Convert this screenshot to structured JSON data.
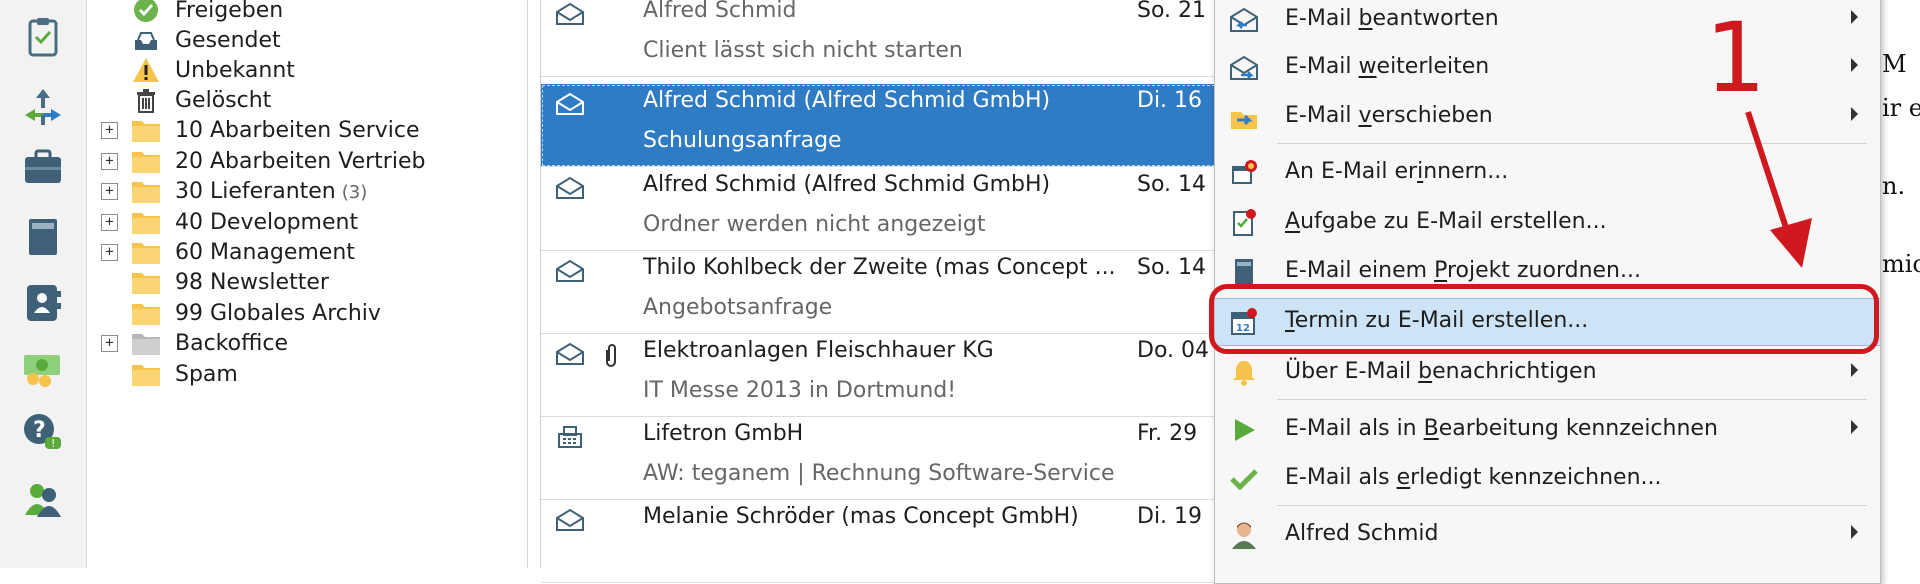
{
  "colors": {
    "accent": "#2f7bc4",
    "annotation": "#d0181f",
    "folder": "#f6c34c",
    "highlight": "#cde4f7"
  },
  "rail": {
    "items": [
      {
        "icon": "tasks-clipboard-icon"
      },
      {
        "icon": "routing-arrows-icon"
      },
      {
        "icon": "briefcase-icon"
      },
      {
        "icon": "archive-cabinet-icon"
      },
      {
        "icon": "contacts-book-icon"
      },
      {
        "icon": "money-icon"
      },
      {
        "icon": "help-chat-icon"
      },
      {
        "icon": "users-icon"
      }
    ]
  },
  "folders": [
    {
      "label": "Freigeben",
      "icon": "check-circle-icon",
      "expandable": false,
      "count": ""
    },
    {
      "label": "Gesendet",
      "icon": "outbox-tray-icon",
      "expandable": false,
      "count": ""
    },
    {
      "label": "Unbekannt",
      "icon": "warning-icon",
      "expandable": false,
      "count": ""
    },
    {
      "label": "Gelöscht",
      "icon": "trash-icon",
      "expandable": false,
      "count": ""
    },
    {
      "label": "10 Abarbeiten Service",
      "icon": "folder-icon",
      "expandable": true,
      "count": ""
    },
    {
      "label": "20 Abarbeiten Vertrieb",
      "icon": "folder-icon",
      "expandable": true,
      "count": ""
    },
    {
      "label": "30 Lieferanten",
      "icon": "folder-icon",
      "expandable": true,
      "count": "(3)"
    },
    {
      "label": "40 Development",
      "icon": "folder-icon",
      "expandable": true,
      "count": ""
    },
    {
      "label": "60 Management",
      "icon": "folder-icon",
      "expandable": true,
      "count": ""
    },
    {
      "label": "98 Newsletter",
      "icon": "folder-icon",
      "expandable": false,
      "count": ""
    },
    {
      "label": "99 Globales Archiv",
      "icon": "folder-icon",
      "expandable": false,
      "count": ""
    },
    {
      "label": "Backoffice",
      "icon": "gray-folder-icon",
      "expandable": true,
      "count": ""
    },
    {
      "label": "Spam",
      "icon": "folder-icon",
      "expandable": false,
      "count": ""
    }
  ],
  "expander_symbol": "+",
  "mails": [
    {
      "sender": "Alfred Schmid",
      "subject": "Client lässt sich nicht starten",
      "day": "So. 21",
      "icon": "envelope-open-icon",
      "attachment": false,
      "selected": false,
      "read": true
    },
    {
      "sender": "Alfred Schmid (Alfred Schmid GmbH)",
      "subject": "Schulungsanfrage",
      "day": "Di. 16",
      "icon": "envelope-open-icon",
      "attachment": false,
      "selected": true,
      "read": false
    },
    {
      "sender": "Alfred Schmid (Alfred Schmid GmbH)",
      "subject": "Ordner werden nicht angezeigt",
      "day": "So. 14",
      "icon": "envelope-open-icon",
      "attachment": false,
      "selected": false,
      "read": false
    },
    {
      "sender": "Thilo Kohlbeck der Zweite (mas Concept ...",
      "subject": "Angebotsanfrage",
      "day": "So. 14",
      "icon": "envelope-open-icon",
      "attachment": false,
      "selected": false,
      "read": false
    },
    {
      "sender": "Elektroanlagen Fleischhauer KG",
      "subject": "IT Messe 2013 in Dortmund!",
      "day": "Do. 04",
      "icon": "envelope-open-icon",
      "attachment": true,
      "selected": false,
      "read": false
    },
    {
      "sender": "Lifetron GmbH",
      "subject": "AW: teganem | Rechnung Software-Service",
      "day": "Fr. 29",
      "icon": "fax-icon",
      "attachment": false,
      "selected": false,
      "read": false
    },
    {
      "sender": "Melanie Schröder (mas Concept GmbH)",
      "subject": "",
      "day": "Di. 19",
      "icon": "envelope-open-icon",
      "attachment": false,
      "selected": false,
      "read": false
    }
  ],
  "reading_pane": {
    "fragments": [
      "M",
      "ir e",
      "n.",
      "mic"
    ]
  },
  "context_menu": {
    "items": [
      {
        "pre": "E-Mail ",
        "key": "b",
        "post": "eantworten",
        "icon": "reply-mail-icon",
        "submenu": true
      },
      {
        "pre": "E-Mail ",
        "key": "w",
        "post": "eiterleiten",
        "icon": "forward-mail-icon",
        "submenu": true
      },
      {
        "pre": "E-Mail ",
        "key": "v",
        "post": "erschieben",
        "icon": "move-mail-icon",
        "submenu": true
      },
      {
        "pre": "An E-Mail er",
        "key": "i",
        "post": "nnern...",
        "icon": "reminder-icon",
        "submenu": false
      },
      {
        "pre": "",
        "key": "A",
        "post": "ufgabe zu E-Mail erstellen...",
        "icon": "task-note-icon",
        "submenu": false
      },
      {
        "pre": "E-Mail einem ",
        "key": "P",
        "post": "rojekt zuordnen...",
        "icon": "project-cabinet-icon",
        "submenu": false
      },
      {
        "pre": "",
        "key": "T",
        "post": "ermin zu E-Mail erstellen...",
        "icon": "calendar-icon",
        "submenu": false,
        "highlighted": true
      },
      {
        "pre": "Über E-Mail ",
        "key": "b",
        "post": "enachrichtigen",
        "icon": "bell-icon",
        "submenu": true
      },
      {
        "pre": "E-Mail als in ",
        "key": "B",
        "post": "earbeitung kennzeichnen",
        "icon": "play-icon",
        "submenu": true
      },
      {
        "pre": "E-Mail als ",
        "key": "e",
        "post": "rledigt kennzeichnen...",
        "icon": "checkmark-icon",
        "submenu": false
      },
      {
        "pre": "Alfred Schmid",
        "key": "",
        "post": "",
        "icon": "person-icon",
        "submenu": true
      }
    ]
  },
  "annotation": {
    "number": "1"
  }
}
